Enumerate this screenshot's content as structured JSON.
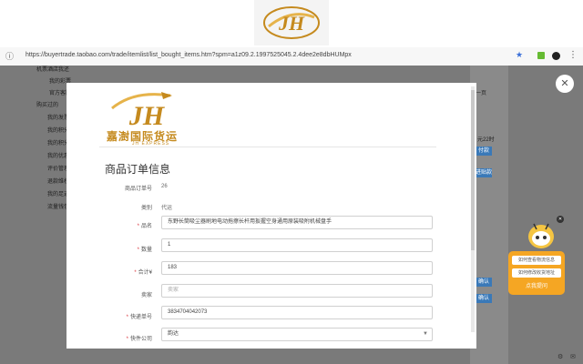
{
  "banner": {
    "logo_letters": "JH"
  },
  "browser": {
    "url": "https://buyertrade.taobao.com/trade/itemlist/list_bought_items.htm?spm=a1z09.2.1997525045.2.4dee2e8dbHUMpx",
    "info_icon": "info-icon",
    "star_icon": "star-icon",
    "menu_icon": "menu-dots-icon"
  },
  "sidebar": {
    "links": [
      "机票酒店我还",
      "我的彩票",
      "官方客服",
      "购买过的",
      "我的发票",
      "我的积分",
      "我的积分",
      "我的优惠",
      "评价管理",
      "退款维权",
      "我的足迹",
      "流量钱包"
    ]
  },
  "right_strip": {
    "prev_page": "一页",
    "time_label": "元22时",
    "btn1": "付款",
    "btn2": "进贴款",
    "btn3": "确认",
    "btn4": "确认"
  },
  "modal": {
    "logo_text": "嘉澍国际货运",
    "logo_sub": "JH EXPRESS",
    "title": "商品订单信息",
    "rows": [
      {
        "label": "商品订单号",
        "value": "26",
        "required": false,
        "type": "static"
      },
      {
        "label": "类别",
        "value": "代运",
        "required": false,
        "type": "static"
      },
      {
        "label": "品名",
        "value": "东野长筒吸尘器刷地电动拖擦长杆用扳握空身通用原装吸附机械盘手",
        "required": true,
        "type": "input"
      },
      {
        "label": "数量",
        "value": "1",
        "required": true,
        "type": "input"
      },
      {
        "label": "合计¥",
        "value": "183",
        "required": true,
        "type": "input"
      },
      {
        "label": "卖家",
        "value": "卖家",
        "required": false,
        "type": "placeholder"
      },
      {
        "label": "快递单号",
        "value": "3834704042073",
        "required": true,
        "type": "input"
      },
      {
        "label": "快件公司",
        "value": "韵达",
        "required": true,
        "type": "select"
      }
    ]
  },
  "help": {
    "item1": "如何查看物流信息",
    "item2": "如何修改收货地址",
    "button": "点我提问"
  },
  "colors": {
    "accent": "#f5a623",
    "required": "#d9363e",
    "logo_gold": "#c58a1e"
  }
}
